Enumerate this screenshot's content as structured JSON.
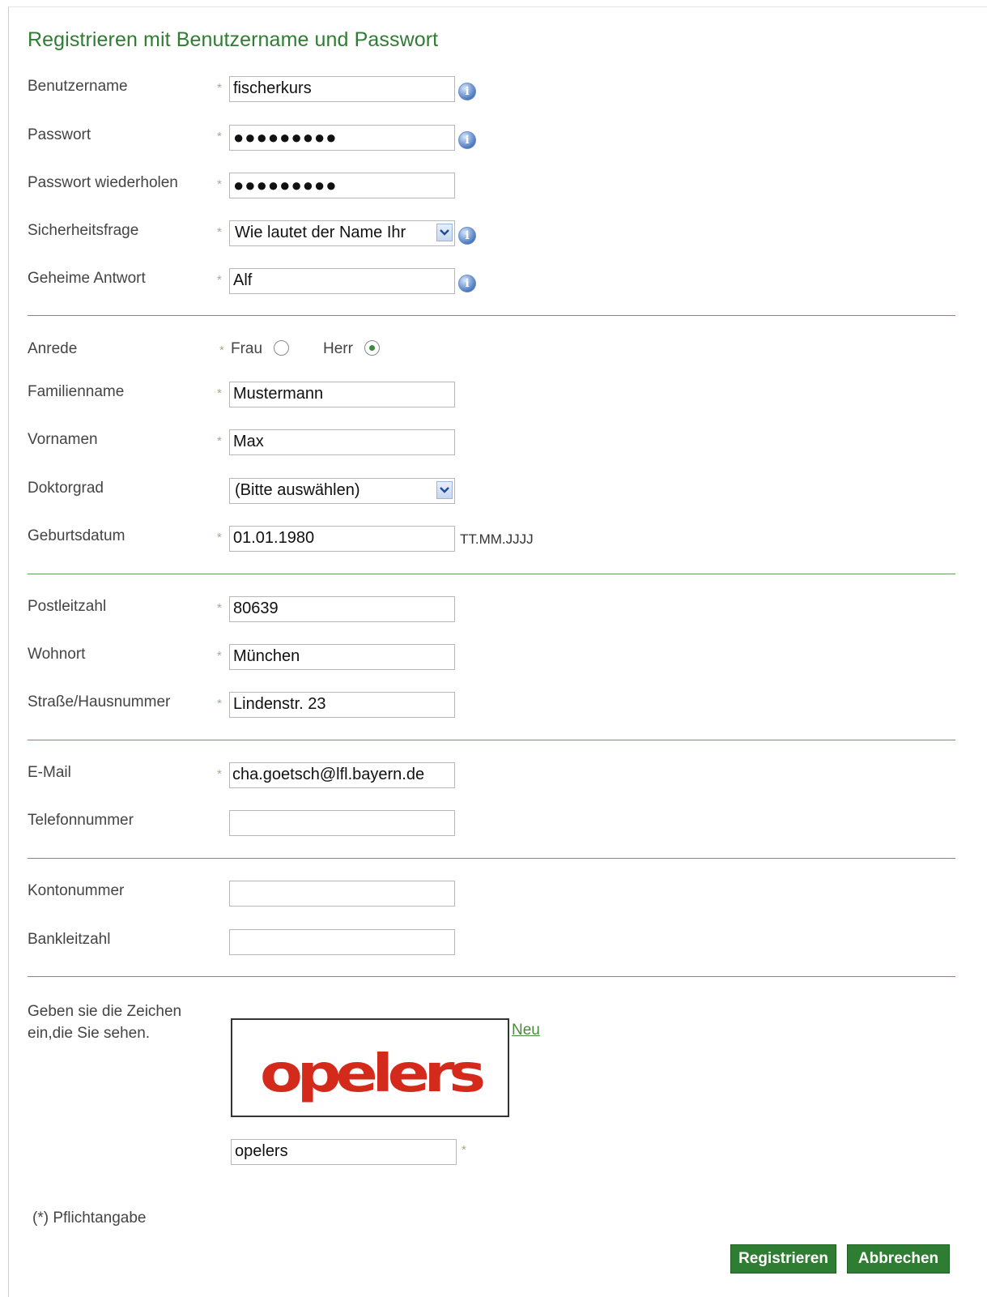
{
  "form": {
    "title": "Registrieren mit Benutzername und Passwort",
    "required_marker": "*",
    "info_glyph": "i",
    "account": {
      "username_label": "Benutzername",
      "username_value": "fischerkurs",
      "password_label": "Passwort",
      "password_value": "●●●●●●●●●",
      "password_repeat_label": "Passwort wiederholen",
      "password_repeat_value": "●●●●●●●●●",
      "security_question_label": "Sicherheitsfrage",
      "security_question_value": "Wie lautet der Name Ihr",
      "secret_answer_label": "Geheime Antwort",
      "secret_answer_value": "Alf"
    },
    "personal": {
      "salutation_label": "Anrede",
      "salutation_options": [
        "Frau",
        "Herr"
      ],
      "salutation_selected": "Herr",
      "lastname_label": "Familienname",
      "lastname_value": "Mustermann",
      "firstname_label": "Vornamen",
      "firstname_value": "Max",
      "doctorate_label": "Doktorgrad",
      "doctorate_value": "(Bitte auswählen)",
      "birthdate_label": "Geburtsdatum",
      "birthdate_value": "01.01.1980",
      "birthdate_format": "TT.MM.JJJJ"
    },
    "address": {
      "zip_label": "Postleitzahl",
      "zip_value": "80639",
      "city_label": "Wohnort",
      "city_value": "München",
      "street_label": "Straße/Hausnummer",
      "street_value": "Lindenstr. 23"
    },
    "contact": {
      "email_label": "E-Mail",
      "email_value": "cha.goetsch@lfl.bayern.de",
      "phone_label": "Telefonnummer",
      "phone_value": ""
    },
    "bank": {
      "account_label": "Kontonummer",
      "account_value": "",
      "bankcode_label": "Bankleitzahl",
      "bankcode_value": ""
    },
    "captcha": {
      "label": "Geben sie die Zeichen ein,die Sie sehen.",
      "refresh_link": "Neu",
      "image_text": "opelers",
      "image_color": "#d42a1c",
      "input_value": "opelers"
    },
    "required_note": "(*) Pflichtangabe",
    "buttons": {
      "register": "Registrieren",
      "cancel": "Abbrechen"
    }
  },
  "colors": {
    "accent": "#2f7d32",
    "divider": "#6a9a63",
    "required_star": "#9bb08d"
  }
}
